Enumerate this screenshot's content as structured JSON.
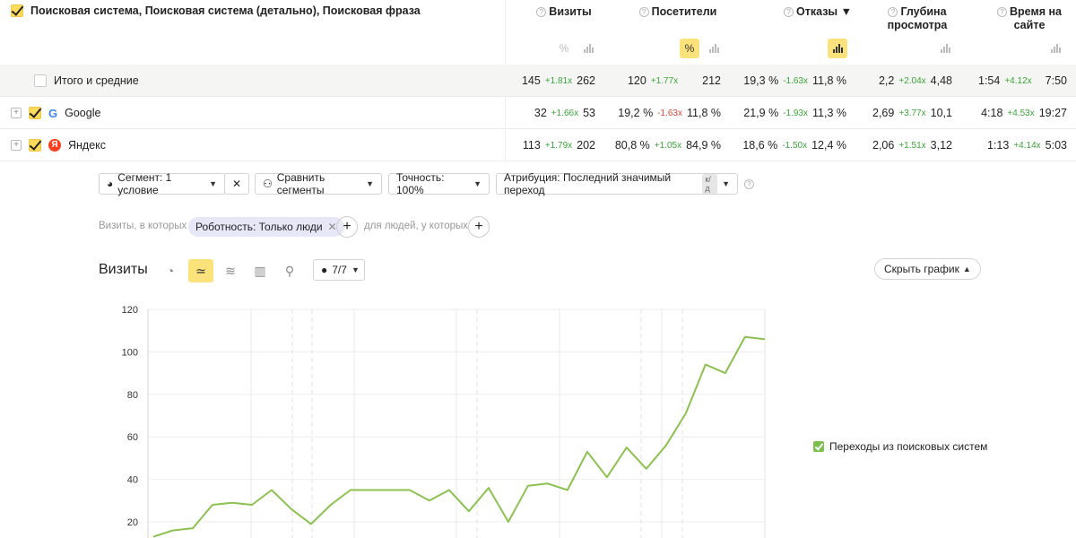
{
  "header": {
    "title": "Поисковая система, Поисковая система (детально), Поисковая фраза",
    "columns": [
      {
        "key": "visits",
        "label": "Визиты"
      },
      {
        "key": "visitors",
        "label": "Посетители"
      },
      {
        "key": "bounces",
        "label": "Отказы ▼"
      },
      {
        "key": "depth",
        "label": "Глубина просмотра"
      },
      {
        "key": "time",
        "label": "Время на сайте"
      }
    ],
    "percent_glyph": "%"
  },
  "rows": [
    {
      "label": "Итого и средние",
      "visits": [
        "145",
        "+1.81x",
        "262"
      ],
      "visitors": [
        "120",
        "+1.77x",
        "212"
      ],
      "bounces": [
        "19,3 %",
        "-1.63x",
        "11,8 %"
      ],
      "depth": [
        "2,2",
        "+2.04x",
        "4,48"
      ],
      "time": [
        "1:54",
        "+4.12x",
        "7:50"
      ]
    },
    {
      "label": "Google",
      "logo": "G",
      "visits": [
        "32",
        "+1.66x",
        "53"
      ],
      "visitors": [
        "19,2 %",
        "-1.63x",
        "11,8 %"
      ],
      "bounces": [
        "21,9 %",
        "-1.93x",
        "11,3 %"
      ],
      "depth": [
        "2,69",
        "+3.77x",
        "10,1"
      ],
      "time": [
        "4:18",
        "+4.53x",
        "19:27"
      ]
    },
    {
      "label": "Яндекс",
      "logo": "Я",
      "visits": [
        "113",
        "+1.79x",
        "202"
      ],
      "visitors": [
        "80,8 %",
        "+1.05x",
        "84,9 %"
      ],
      "bounces": [
        "18,6 %",
        "-1.50x",
        "12,4 %"
      ],
      "depth": [
        "2,06",
        "+1.51x",
        "3,12"
      ],
      "time": [
        "1:13",
        "+4.14x",
        "5:03"
      ]
    }
  ],
  "filters": {
    "segment": "Сегмент: 1 условие",
    "compare": "Сравнить сегменты",
    "accuracy": "Точность: 100%",
    "attribution": "Атрибуция: Последний значимый переход",
    "attribution_tag": "к/д",
    "visits_where": "Визиты, в которых",
    "robotness": "Роботность: Только люди",
    "for_people": "для людей, у которых"
  },
  "chart_toolbar": {
    "title": "Визиты",
    "annotations": "7/7",
    "hide_chart": "Скрыть график"
  },
  "chart_data": {
    "type": "line",
    "ylim": [
      0,
      120
    ],
    "yticks": [
      "120",
      "100",
      "80",
      "60",
      "40",
      "20"
    ],
    "series": [
      {
        "name": "Переходы из поисковых систем",
        "color": "#8cc152",
        "values": [
          13,
          16,
          17,
          28,
          29,
          28,
          35,
          26,
          19,
          28,
          35,
          35,
          35,
          35,
          30,
          35,
          25,
          36,
          20,
          37,
          38,
          35,
          53,
          41,
          55,
          45,
          56,
          71,
          94,
          90,
          107,
          106
        ]
      }
    ]
  }
}
